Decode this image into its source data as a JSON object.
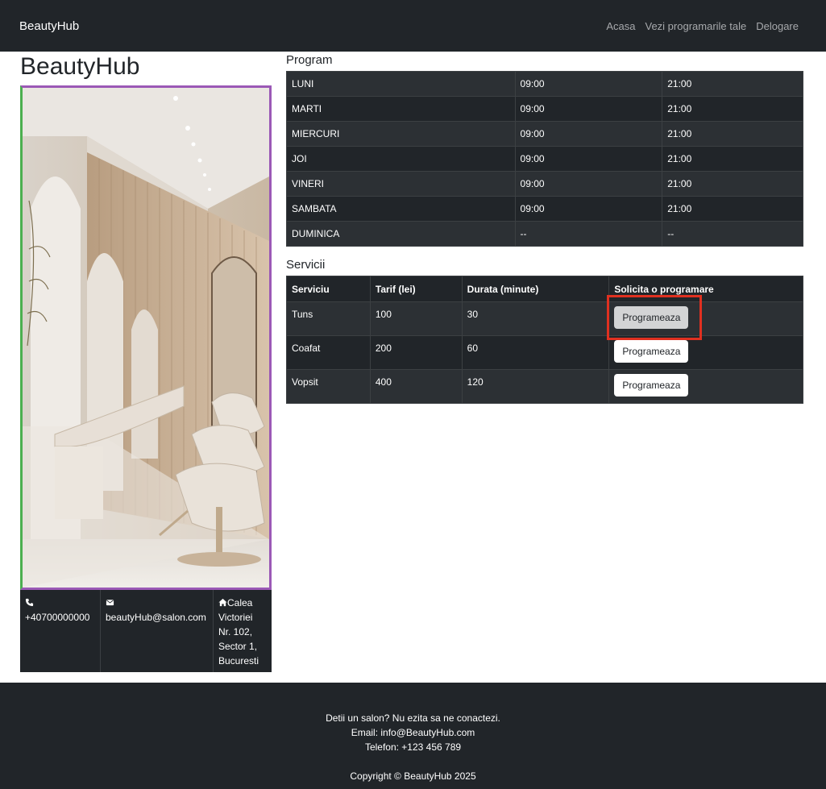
{
  "navbar": {
    "brand": "BeautyHub",
    "links": [
      "Acasa",
      "Vezi programarile tale",
      "Delogare"
    ]
  },
  "salon": {
    "name": "BeautyHub",
    "photo_icon": "salon-interior-photo"
  },
  "contact": {
    "phone": "+40700000000",
    "email": "beautyHub@salon.com",
    "address": [
      "Calea",
      "Victoriei",
      "Nr. 102,",
      "Sector 1,",
      "Bucuresti"
    ]
  },
  "program": {
    "title": "Program",
    "rows": [
      {
        "day": "LUNI",
        "open": "09:00",
        "close": "21:00"
      },
      {
        "day": "MARTI",
        "open": "09:00",
        "close": "21:00"
      },
      {
        "day": "MIERCURI",
        "open": "09:00",
        "close": "21:00"
      },
      {
        "day": "JOI",
        "open": "09:00",
        "close": "21:00"
      },
      {
        "day": "VINERI",
        "open": "09:00",
        "close": "21:00"
      },
      {
        "day": "SAMBATA",
        "open": "09:00",
        "close": "21:00"
      },
      {
        "day": "DUMINICA",
        "open": "--",
        "close": "--"
      }
    ]
  },
  "services": {
    "title": "Servicii",
    "headers": [
      "Serviciu",
      "Tarif (lei)",
      "Durata (minute)",
      "Solicita o programare"
    ],
    "rows": [
      {
        "name": "Tuns",
        "price": "100",
        "duration": "30",
        "button": "Programeaza"
      },
      {
        "name": "Coafat",
        "price": "200",
        "duration": "60",
        "button": "Programeaza"
      },
      {
        "name": "Vopsit",
        "price": "400",
        "duration": "120",
        "button": "Programeaza"
      }
    ]
  },
  "footer": {
    "line1": "Detii un salon? Nu ezita sa ne conactezi.",
    "line2": "Email: info@BeautyHub.com",
    "line3": "Telefon: +123 456 789",
    "copyright": "Copyright © BeautyHub 2025"
  },
  "colors": {
    "dark": "#212529",
    "highlight": "#e03020"
  }
}
